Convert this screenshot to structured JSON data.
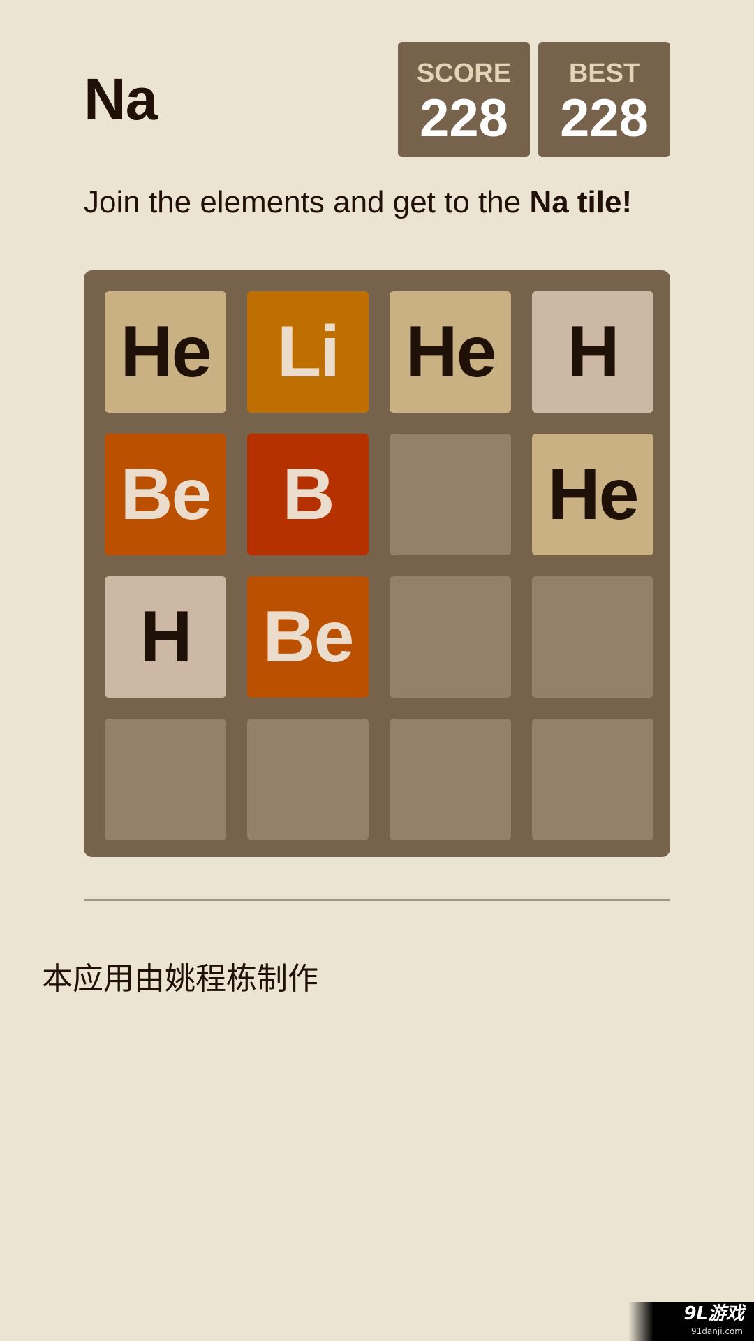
{
  "header": {
    "title": "Na",
    "score_label": "SCORE",
    "score_value": "228",
    "best_label": "BEST",
    "best_value": "228"
  },
  "intro": {
    "text_prefix": "Join the elements and get to the ",
    "text_bold": "Na tile!"
  },
  "board": {
    "rows": [
      [
        "He",
        "Li",
        "He",
        "H"
      ],
      [
        "Be",
        "B",
        "",
        "He"
      ],
      [
        "H",
        "Be",
        "",
        ""
      ],
      [
        "",
        "",
        "",
        ""
      ]
    ]
  },
  "colors": {
    "background": "#ece4d3",
    "board": "#77624c",
    "empty_cell": "#958169",
    "H": "#cdb8a5",
    "He": "#c9b184",
    "Li": "#be6f00",
    "Be": "#bb5100",
    "B": "#b53200"
  },
  "footer": {
    "credit": "本应用由姚程栋制作"
  },
  "watermark": {
    "logo": "9L游戏",
    "site": "91danji.com"
  }
}
